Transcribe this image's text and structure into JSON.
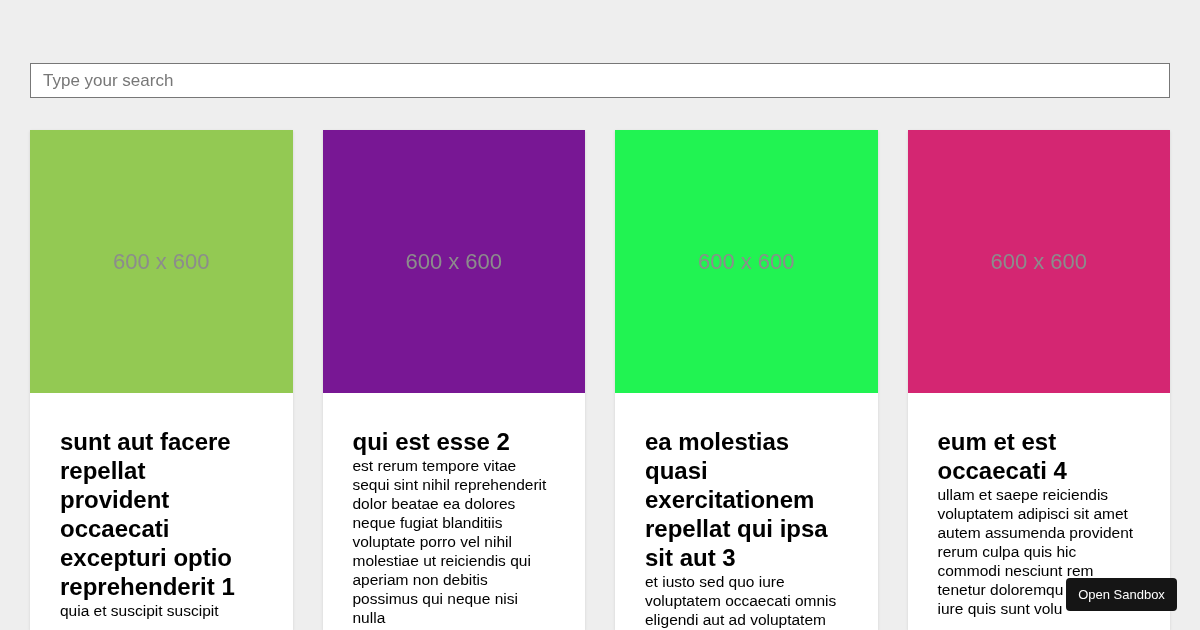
{
  "search": {
    "placeholder": "Type your search"
  },
  "cards": [
    {
      "color": "#93c953",
      "image_label": "600 x 600",
      "title": "sunt aut facere repellat provident occaecati excepturi optio reprehenderit 1",
      "body_lines": [
        "quia et suscipit suscipit"
      ]
    },
    {
      "color": "#781794",
      "image_label": "600 x 600",
      "title": "qui est esse 2",
      "body_lines": [
        "est rerum tempore vitae",
        "sequi sint nihil reprehenderit",
        "dolor beatae ea dolores",
        "neque fugiat blanditiis",
        "voluptate porro vel nihil",
        "molestiae ut reiciendis qui",
        "aperiam non debitis",
        "possimus qui neque nisi",
        "nulla"
      ]
    },
    {
      "color": "#21f352",
      "image_label": "600 x 600",
      "title": "ea molestias quasi exercitationem repellat qui ipsa sit aut 3",
      "body_lines": [
        "et iusto sed quo iure",
        "voluptatem occaecati omnis",
        "eligendi aut ad voluptatem"
      ]
    },
    {
      "color": "#d42672",
      "image_label": "600 x 600",
      "title": "eum et est occaecati 4",
      "body_lines": [
        "ullam et saepe reiciendis",
        "voluptatem adipisci sit amet",
        "autem assumenda provident",
        "rerum culpa quis hic",
        "commodi nesciunt rem",
        "tenetur doloremqu",
        "iure quis sunt volu"
      ]
    }
  ],
  "sandbox_button": "Open Sandbox"
}
